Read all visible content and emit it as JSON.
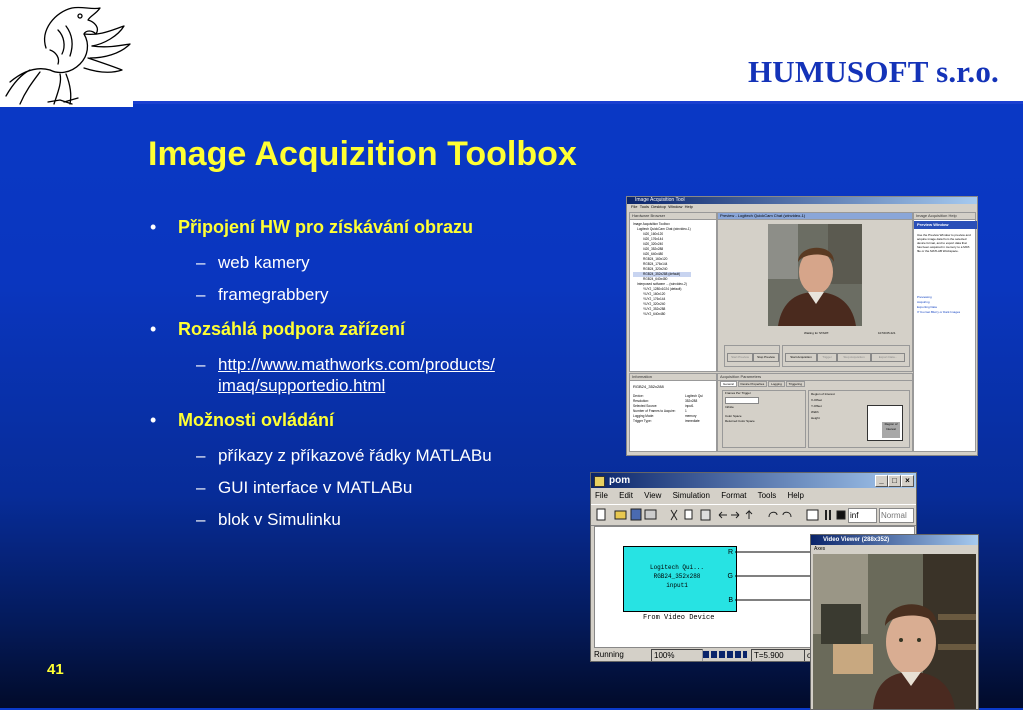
{
  "header": {
    "company": "HUMUSOFT s.r.o."
  },
  "slide": {
    "title": "Image Acquizition Toolbox",
    "page_number": "41",
    "bullets": [
      {
        "text": "Připojení HW pro získávání obrazu",
        "sub": [
          "web kamery",
          "framegrabbery"
        ]
      },
      {
        "text": "Rozsáhlá podpora zařízení",
        "link_line1": "http://www.mathworks.com/products/",
        "link_line2": "imaq/supportedio.html"
      },
      {
        "text": "Možnosti ovládání",
        "sub": [
          "příkazy z příkazové řádky MATLABu",
          "GUI interface v MATLABu",
          "blok v Simulinku"
        ]
      }
    ]
  },
  "acq_tool": {
    "title": "Image Acquisition Tool",
    "menu": [
      "File",
      "Tools",
      "Desktop",
      "Window",
      "Help"
    ],
    "hardware_browser": "Hardware Browser",
    "tree": [
      "Image Acquisition Toolbox",
      "Logitech QuickCam Chat (winvideo-1)",
      "I420_160x120",
      "I420_176x144",
      "I420_320x240",
      "I420_352x288",
      "I420_640x480",
      "RGB24_160x120",
      "RGB24_176x144",
      "RGB24_320x240",
      "RGB24_352x288 (default)",
      "RGB24_640x480",
      "Interposed software ... (winvideo-2)",
      "YUY2_1280x1024 (default)",
      "YUY2_160x120",
      "YUY2_176x144",
      "YUY2_320x240",
      "YUY2_352x288",
      "YUY2_640x480"
    ],
    "preview_title": "Preview - Logitech QuickCam Chat (winvideo-1)",
    "waiting": "Waiting for START.",
    "time": "10:59:05.221",
    "preview_buttons": [
      "Start Preview",
      "Stop Preview"
    ],
    "acquire_buttons": [
      "Start Acquisition",
      "Trigger",
      "Stop Acquisition",
      "Export Data..."
    ],
    "help_title": "Image Acquisition Help",
    "help_heading": "Preview Window",
    "help_text": "Use the Preview Window to preview and acquire image data from the selected device format, and to export data that has been acquired in memory to a MAT-file or the MATLAB Workspace.",
    "help_links": [
      "Previewing",
      "Acquiring",
      "Exporting Data",
      "If You Get Blurry or Dark Images"
    ],
    "info_title": "Information",
    "info_format": "RGB24_352x288",
    "info_rows": [
      [
        "Device:",
        "Logitech Qui"
      ],
      [
        "Resolution:",
        "352x288"
      ],
      [
        "Selected Source:",
        "input1"
      ],
      [
        "Number of Frames to Acquire:",
        "1"
      ],
      [
        "Logging Mode:",
        "memory"
      ],
      [
        "Trigger Type:",
        "immediate"
      ]
    ],
    "params_title": "Acquisition Parameters",
    "params_tabs": [
      "General",
      "Device Properties",
      "Logging",
      "Triggering"
    ],
    "params_labels": [
      "Frames Per Trigger",
      "Infinite",
      "Color Space",
      "Returned Color Space",
      "Region of Interest",
      "X-Offset",
      "Y-Offset",
      "Width",
      "Height",
      "Region of Interest"
    ]
  },
  "simulink": {
    "title": "pom",
    "menu": [
      "File",
      "Edit",
      "View",
      "Simulation",
      "Format",
      "Tools",
      "Help"
    ],
    "sim_time": "inf",
    "mode": "Normal",
    "block_lines": [
      "Logitech Qui...",
      "RGB24_352x288",
      "input1"
    ],
    "block_label": "From Video Device",
    "ports": [
      "R",
      "G",
      "B"
    ],
    "status": [
      "Running",
      "100%",
      "T=5.900",
      "ode"
    ]
  },
  "video_viewer": {
    "title": "Video Viewer (288x352)",
    "menu": "Axes"
  }
}
